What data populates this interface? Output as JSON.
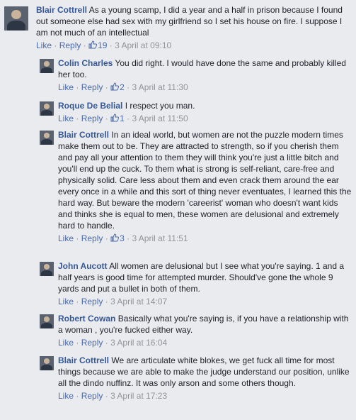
{
  "actions": {
    "like": "Like",
    "reply": "Reply",
    "separator": "·"
  },
  "comments": [
    {
      "author": "Blair Cottrell",
      "text": "As a young scamp, I did a year and a half in prison because I found out someone else had sex with my girlfriend so I set his house on fire. I suppose I am not much of an intellectual",
      "likes": "19",
      "time": "3 April at 09:10",
      "avatar": "person-silhouette"
    },
    {
      "author": "Colin Charles",
      "text": "You did right. I would have done the same and probably killed her too.",
      "likes": "2",
      "time": "3 April at 11:30",
      "avatar": "person-silhouette"
    },
    {
      "author": "Roque De Belial",
      "text": "I respect you man.",
      "likes": "1",
      "time": "3 April at 11:50",
      "avatar": "person-silhouette"
    },
    {
      "author": "Blair Cottrell",
      "text": "In an ideal world, but women are not the puzzle modern times make them out to be. They are attracted to strength, so if you cherish them and pay all your attention to them they will think you're just a little bitch and you'll end up the cuck. To them what is strong is self-reliant, care-free and physically solid. Care less about them and even crack them around the ear every once in a while and this sort of thing never eventuates, I learned this the hard way. But beware the modern 'careerist' woman who doesn't want kids and thinks she is equal to men, these women are delusional and extremely hard to handle.",
      "likes": "3",
      "time": "3 April at 11:51",
      "avatar": "person-silhouette"
    },
    {
      "author": "John Aucott",
      "text": "All women are delusional but I see what you're saying. 1 and a half years is good time for attempted murder. Should've gone the whole 9 yards and put a bullet in both of them.",
      "likes": "",
      "time": "3 April at 14:07",
      "avatar": "person-silhouette"
    },
    {
      "author": "Robert Cowan",
      "text": "Basically what you're saying is, if you have a relationship with a woman , you're fucked either way.",
      "likes": "",
      "time": "3 April at 16:04",
      "avatar": "person-silhouette"
    },
    {
      "author": "Blair Cottrell",
      "text": "We are articulate white blokes, we get fuck all time for most things because we are able to make the judge understand our position, unlike all the dindo nuffinz. It was only arson and some others though.",
      "likes": "",
      "time": "3 April at 17:23",
      "avatar": "person-silhouette"
    }
  ],
  "colors": {
    "background": "#e9ebee",
    "author": "#365899",
    "link": "#4b6aaa",
    "meta": "#90949c",
    "text": "#1d2129"
  }
}
